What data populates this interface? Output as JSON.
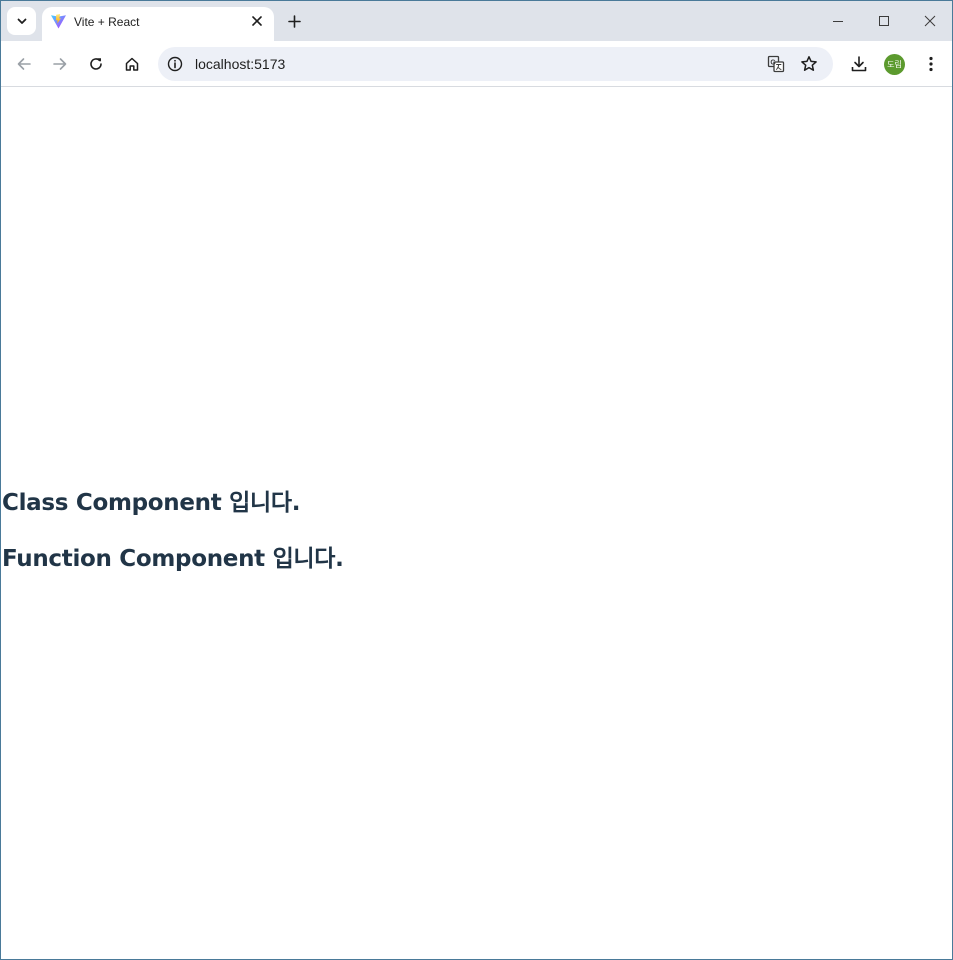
{
  "browser": {
    "tab": {
      "title": "Vite + React",
      "favicon": "vite-logo-icon"
    },
    "address_bar": {
      "url": "localhost:5173"
    },
    "profile": {
      "avatar_text": "도림",
      "avatar_color": "#5c9a2e"
    },
    "icons": {
      "tab_search": "chevron-down-icon",
      "tab_close": "close-icon",
      "new_tab": "plus-icon",
      "minimize": "minimize-icon",
      "maximize": "maximize-icon",
      "window_close": "close-icon",
      "back": "arrow-left-icon",
      "forward": "arrow-right-icon",
      "reload": "reload-icon",
      "home": "home-icon",
      "site_info": "info-icon",
      "translate": "translate-icon",
      "bookmark": "star-icon",
      "downloads": "download-icon",
      "menu": "kebab-menu-icon"
    }
  },
  "page": {
    "headings": [
      "Class Component 입니다.",
      "Function Component 입니다."
    ],
    "text_color": "#213547"
  }
}
